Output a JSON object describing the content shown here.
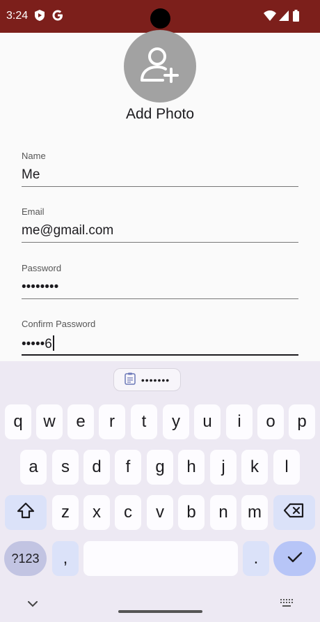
{
  "status_bar": {
    "time": "3:24",
    "icons": [
      "shield-play-icon",
      "google-g-icon",
      "wifi-icon",
      "signal-icon",
      "battery-icon"
    ],
    "color": "#7c1f1b"
  },
  "profile": {
    "avatar_icon": "person-add-icon",
    "add_photo_label": "Add Photo"
  },
  "form": {
    "name": {
      "label": "Name",
      "value": "Me"
    },
    "email": {
      "label": "Email",
      "value": "me@gmail.com"
    },
    "password": {
      "label": "Password",
      "value": "••••••••"
    },
    "confirm_password": {
      "label": "Confirm Password",
      "value": "•••••6"
    }
  },
  "keyboard": {
    "suggestion": "•••••••",
    "row1": [
      "q",
      "w",
      "e",
      "r",
      "t",
      "y",
      "u",
      "i",
      "o",
      "p"
    ],
    "row2": [
      "a",
      "s",
      "d",
      "f",
      "g",
      "h",
      "j",
      "k",
      "l"
    ],
    "row3": [
      "z",
      "x",
      "c",
      "v",
      "b",
      "n",
      "m"
    ],
    "symbols_label": "?123",
    "comma_label": ",",
    "period_label": ".",
    "colors": {
      "background": "#ede9f3",
      "key": "#fdfcff",
      "function_key": "#dbe2f9",
      "enter_key": "#b7c5f7"
    }
  }
}
